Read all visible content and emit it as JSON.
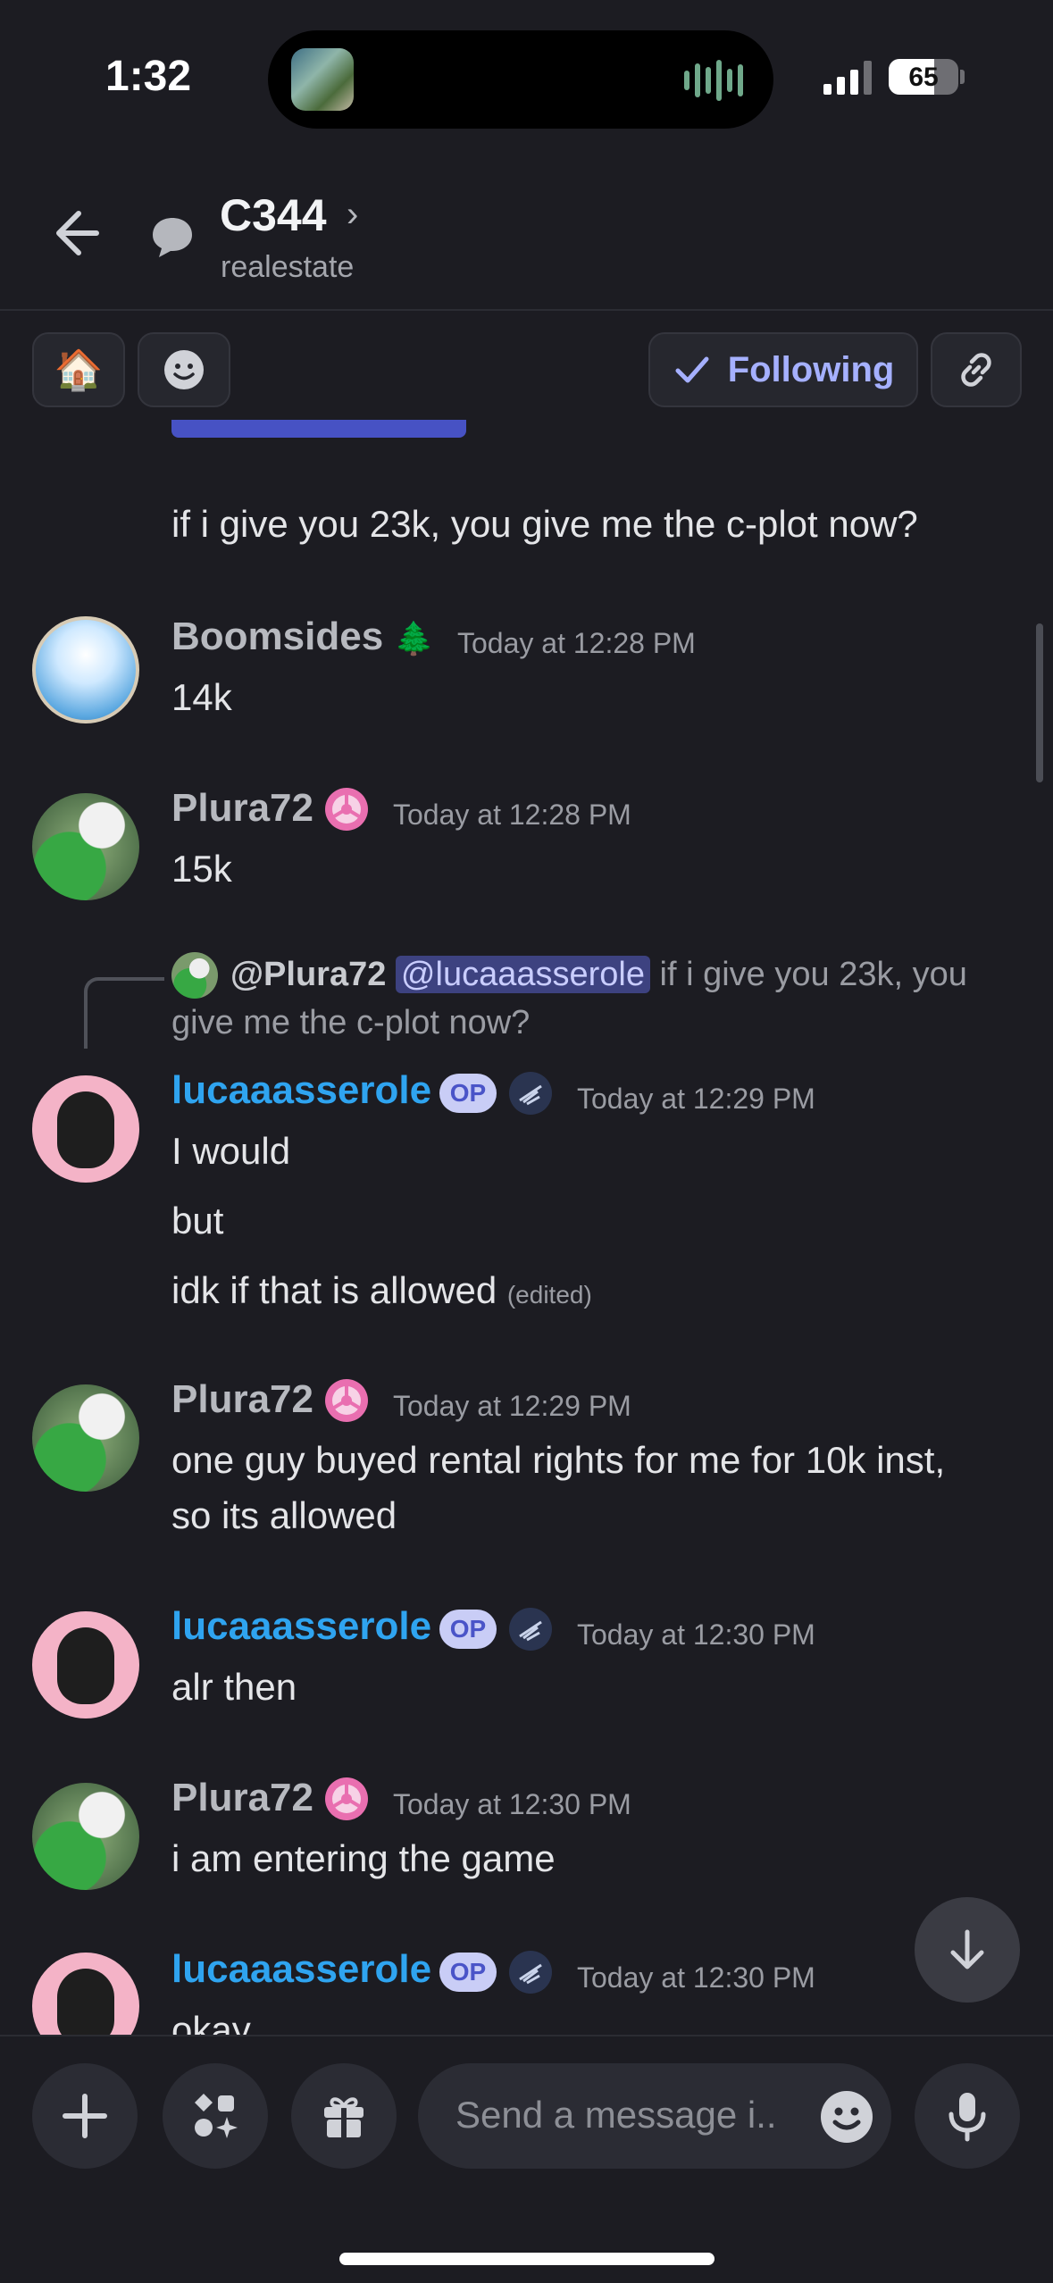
{
  "status_bar": {
    "time": "1:32",
    "battery": "65",
    "battery_level": 0.65
  },
  "header": {
    "title": "C344",
    "chevron": "›",
    "subtitle": "realestate"
  },
  "actions": {
    "house_emoji": "🏠",
    "follow_label": "Following"
  },
  "messages": [
    {
      "text": "if i give you 23k, you give me the c-plot now?"
    },
    {
      "author": "Boomsides",
      "author_emoji": "🌲",
      "time": "Today at 12:28 PM",
      "lines": [
        "14k"
      ]
    },
    {
      "author": "Plura72",
      "time": "Today at 12:28 PM",
      "lines": [
        "15k"
      ]
    },
    {
      "reply": {
        "user": "@Plura72",
        "mention": "@lucaaasserole",
        "text": "if i give you 23k, you give me the c-plot now?"
      },
      "author": "lucaaasserole",
      "badge": "OP",
      "time": "Today at 12:29 PM",
      "lines": [
        "I would",
        "but",
        "idk if that is allowed"
      ],
      "edited": "(edited)"
    },
    {
      "author": "Plura72",
      "time": "Today at 12:29 PM",
      "lines": [
        "one guy buyed rental rights for me for 10k inst,",
        "so its allowed"
      ]
    },
    {
      "author": "lucaaasserole",
      "badge": "OP",
      "time": "Today at 12:30 PM",
      "lines": [
        "alr then"
      ]
    },
    {
      "author": "Plura72",
      "time": "Today at 12:30 PM",
      "lines": [
        "i am entering the game"
      ]
    },
    {
      "author": "lucaaasserole",
      "badge": "OP",
      "time": "Today at 12:30 PM",
      "lines": [
        "okay"
      ]
    }
  ],
  "composer": {
    "placeholder": "Send a message i.."
  }
}
